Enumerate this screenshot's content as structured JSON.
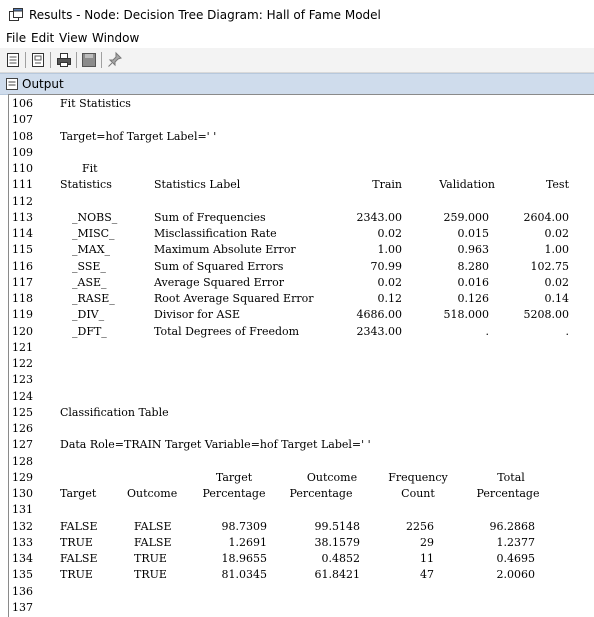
{
  "window": {
    "title": "Results - Node: Decision Tree Diagram: Hall of Fame Model"
  },
  "menu": {
    "items": [
      "File",
      "Edit",
      "View",
      "Window"
    ]
  },
  "panel": {
    "title": "Output"
  },
  "output": {
    "line_numbers": [
      "106",
      "107",
      "108",
      "109",
      "110",
      "111",
      "112",
      "113",
      "114",
      "115",
      "116",
      "117",
      "118",
      "119",
      "120",
      "121",
      "122",
      "123",
      "124",
      "125",
      "126",
      "127",
      "128",
      "129",
      "130",
      "131",
      "132",
      "133",
      "134",
      "135",
      "136",
      "137"
    ],
    "fit_title": "Fit Statistics",
    "fit_target": "Target=hof Target Label=' '",
    "fit_header_top": "Fit",
    "fit_headers": [
      "Statistics",
      "Statistics Label",
      "Train",
      "Validation",
      "Test"
    ],
    "fit_rows": [
      [
        "_NOBS_",
        "Sum of Frequencies",
        "2343.00",
        "259.000",
        "2604.00"
      ],
      [
        "_MISC_",
        "Misclassification Rate",
        "0.02",
        "0.015",
        "0.02"
      ],
      [
        "_MAX_",
        "Maximum Absolute Error",
        "1.00",
        "0.963",
        "1.00"
      ],
      [
        "_SSE_",
        "Sum of Squared Errors",
        "70.99",
        "8.280",
        "102.75"
      ],
      [
        "_ASE_",
        "Average Squared Error",
        "0.02",
        "0.016",
        "0.02"
      ],
      [
        "_RASE_",
        "Root Average Squared Error",
        "0.12",
        "0.126",
        "0.14"
      ],
      [
        "_DIV_",
        "Divisor for ASE",
        "4686.00",
        "518.000",
        "5208.00"
      ],
      [
        "_DFT_",
        "Total Degrees of Freedom",
        "2343.00",
        ".",
        "."
      ]
    ],
    "class_title": "Classification Table",
    "class_role": "Data Role=TRAIN Target Variable=hof Target Label=' '",
    "class_headers_top": [
      "Target",
      "Outcome",
      "Frequency",
      "Total"
    ],
    "class_headers": [
      "Target",
      "Outcome",
      "Percentage",
      "Percentage",
      "Count",
      "Percentage"
    ],
    "class_rows": [
      [
        "FALSE",
        "FALSE",
        "98.7309",
        "99.5148",
        "2256",
        "96.2868"
      ],
      [
        "TRUE",
        "FALSE",
        "1.2691",
        "38.1579",
        "29",
        "1.2377"
      ],
      [
        "FALSE",
        "TRUE",
        "18.9655",
        "0.4852",
        "11",
        "0.4695"
      ],
      [
        "TRUE",
        "TRUE",
        "81.0345",
        "61.8421",
        "47",
        "2.0060"
      ]
    ]
  },
  "icons": {
    "app": "results-window-icon",
    "toolbar": [
      "new-document-icon",
      "properties-icon",
      "print-icon",
      "save-icon",
      "pin-icon"
    ],
    "panel": "output-panel-icon"
  }
}
